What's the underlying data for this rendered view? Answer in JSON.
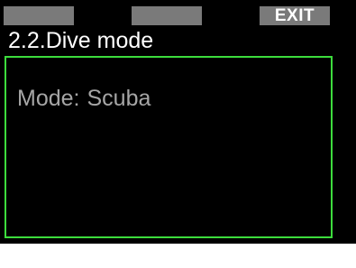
{
  "softkeys": {
    "left_label": "",
    "middle_label": "",
    "right_label": "EXIT"
  },
  "header": {
    "title": "2.2.Dive mode"
  },
  "content": {
    "mode_label": "Mode:",
    "mode_value": "Scuba"
  },
  "colors": {
    "background": "#000000",
    "softkey": "#7a7a7a",
    "title_text": "#ffffff",
    "frame": "#3cdc3c",
    "value_text": "#a6a6a6"
  }
}
